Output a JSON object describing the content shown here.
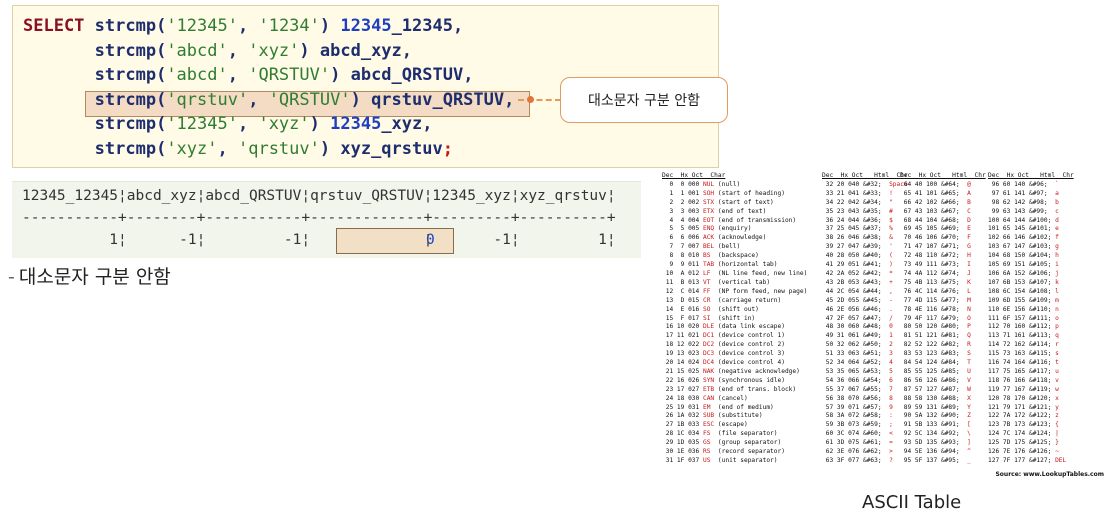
{
  "sql": {
    "keyword": "SELECT",
    "lines": [
      {
        "fn": "strcmp",
        "a": "'12345'",
        "b": "'1234'",
        "alias_num": "12345",
        "alias_rest": "_12345",
        "end": ","
      },
      {
        "fn": "strcmp",
        "a": "'abcd'",
        "b": "'xyz'",
        "alias_num": "",
        "alias_rest": "abcd_xyz",
        "end": ","
      },
      {
        "fn": "strcmp",
        "a": "'abcd'",
        "b": "'QRSTUV'",
        "alias_num": "",
        "alias_rest": "abcd_QRSTUV",
        "end": ","
      },
      {
        "fn": "strcmp",
        "a": "'qrstuv'",
        "b": "'QRSTUV'",
        "alias_num": "",
        "alias_rest": "qrstuv_QRSTUV",
        "end": ","
      },
      {
        "fn": "strcmp",
        "a": "'12345'",
        "b": "'xyz'",
        "alias_num": "12345",
        "alias_rest": "_xyz",
        "end": ","
      },
      {
        "fn": "strcmp",
        "a": "'xyz'",
        "b": "'qrstuv'",
        "alias_num": "",
        "alias_rest": "xyz_qrstuv",
        "end": ";"
      }
    ]
  },
  "callout_text": "대소문자 구분 안함",
  "result": {
    "header": "12345_12345¦abcd_xyz¦abcd_QRSTUV¦qrstuv_QRSTUV¦12345_xyz¦xyz_qrstuv¦",
    "separator": "-----------+--------+-----------+-------------+---------+----------+",
    "row": "          1¦      -1¦         -1¦             ¦       -1¦         1¦",
    "highlight_value": "0"
  },
  "note": {
    "dash": "-",
    "text": "대소문자 구분 안함"
  },
  "ascii": {
    "headers": [
      "Dec  Hx Oct  Char",
      "Dec  Hx Oct   Html  Chr",
      "Dec  Hx Oct   Html  Chr",
      "Dec  Hx Oct   Html  Chr"
    ],
    "col1": [
      [
        "0",
        "0",
        "000",
        "NUL",
        "(null)"
      ],
      [
        "1",
        "1",
        "001",
        "SOH",
        "(start of heading)"
      ],
      [
        "2",
        "2",
        "002",
        "STX",
        "(start of text)"
      ],
      [
        "3",
        "3",
        "003",
        "ETX",
        "(end of text)"
      ],
      [
        "4",
        "4",
        "004",
        "EOT",
        "(end of transmission)"
      ],
      [
        "5",
        "5",
        "005",
        "ENQ",
        "(enquiry)"
      ],
      [
        "6",
        "6",
        "006",
        "ACK",
        "(acknowledge)"
      ],
      [
        "7",
        "7",
        "007",
        "BEL",
        "(bell)"
      ],
      [
        "8",
        "8",
        "010",
        "BS",
        "(backspace)"
      ],
      [
        "9",
        "9",
        "011",
        "TAB",
        "(horizontal tab)"
      ],
      [
        "10",
        "A",
        "012",
        "LF",
        "(NL line feed, new line)"
      ],
      [
        "11",
        "B",
        "013",
        "VT",
        "(vertical tab)"
      ],
      [
        "12",
        "C",
        "014",
        "FF",
        "(NP form feed, new page)"
      ],
      [
        "13",
        "D",
        "015",
        "CR",
        "(carriage return)"
      ],
      [
        "14",
        "E",
        "016",
        "SO",
        "(shift out)"
      ],
      [
        "15",
        "F",
        "017",
        "SI",
        "(shift in)"
      ],
      [
        "16",
        "10",
        "020",
        "DLE",
        "(data link escape)"
      ],
      [
        "17",
        "11",
        "021",
        "DC1",
        "(device control 1)"
      ],
      [
        "18",
        "12",
        "022",
        "DC2",
        "(device control 2)"
      ],
      [
        "19",
        "13",
        "023",
        "DC3",
        "(device control 3)"
      ],
      [
        "20",
        "14",
        "024",
        "DC4",
        "(device control 4)"
      ],
      [
        "21",
        "15",
        "025",
        "NAK",
        "(negative acknowledge)"
      ],
      [
        "22",
        "16",
        "026",
        "SYN",
        "(synchronous idle)"
      ],
      [
        "23",
        "17",
        "027",
        "ETB",
        "(end of trans. block)"
      ],
      [
        "24",
        "18",
        "030",
        "CAN",
        "(cancel)"
      ],
      [
        "25",
        "19",
        "031",
        "EM",
        "(end of medium)"
      ],
      [
        "26",
        "1A",
        "032",
        "SUB",
        "(substitute)"
      ],
      [
        "27",
        "1B",
        "033",
        "ESC",
        "(escape)"
      ],
      [
        "28",
        "1C",
        "034",
        "FS",
        "(file separator)"
      ],
      [
        "29",
        "1D",
        "035",
        "GS",
        "(group separator)"
      ],
      [
        "30",
        "1E",
        "036",
        "RS",
        "(record separator)"
      ],
      [
        "31",
        "1F",
        "037",
        "US",
        "(unit separator)"
      ]
    ],
    "col2": [
      [
        "32",
        "20",
        "040",
        "&#32;",
        "Space"
      ],
      [
        "33",
        "21",
        "041",
        "&#33;",
        "!"
      ],
      [
        "34",
        "22",
        "042",
        "&#34;",
        "\""
      ],
      [
        "35",
        "23",
        "043",
        "&#35;",
        "#"
      ],
      [
        "36",
        "24",
        "044",
        "&#36;",
        "$"
      ],
      [
        "37",
        "25",
        "045",
        "&#37;",
        "%"
      ],
      [
        "38",
        "26",
        "046",
        "&#38;",
        "&"
      ],
      [
        "39",
        "27",
        "047",
        "&#39;",
        "'"
      ],
      [
        "40",
        "28",
        "050",
        "&#40;",
        "("
      ],
      [
        "41",
        "29",
        "051",
        "&#41;",
        ")"
      ],
      [
        "42",
        "2A",
        "052",
        "&#42;",
        "*"
      ],
      [
        "43",
        "2B",
        "053",
        "&#43;",
        "+"
      ],
      [
        "44",
        "2C",
        "054",
        "&#44;",
        ","
      ],
      [
        "45",
        "2D",
        "055",
        "&#45;",
        "-"
      ],
      [
        "46",
        "2E",
        "056",
        "&#46;",
        "."
      ],
      [
        "47",
        "2F",
        "057",
        "&#47;",
        "/"
      ],
      [
        "48",
        "30",
        "060",
        "&#48;",
        "0"
      ],
      [
        "49",
        "31",
        "061",
        "&#49;",
        "1"
      ],
      [
        "50",
        "32",
        "062",
        "&#50;",
        "2"
      ],
      [
        "51",
        "33",
        "063",
        "&#51;",
        "3"
      ],
      [
        "52",
        "34",
        "064",
        "&#52;",
        "4"
      ],
      [
        "53",
        "35",
        "065",
        "&#53;",
        "5"
      ],
      [
        "54",
        "36",
        "066",
        "&#54;",
        "6"
      ],
      [
        "55",
        "37",
        "067",
        "&#55;",
        "7"
      ],
      [
        "56",
        "38",
        "070",
        "&#56;",
        "8"
      ],
      [
        "57",
        "39",
        "071",
        "&#57;",
        "9"
      ],
      [
        "58",
        "3A",
        "072",
        "&#58;",
        ":"
      ],
      [
        "59",
        "3B",
        "073",
        "&#59;",
        ";"
      ],
      [
        "60",
        "3C",
        "074",
        "&#60;",
        "<"
      ],
      [
        "61",
        "3D",
        "075",
        "&#61;",
        "="
      ],
      [
        "62",
        "3E",
        "076",
        "&#62;",
        ">"
      ],
      [
        "63",
        "3F",
        "077",
        "&#63;",
        "?"
      ]
    ],
    "col3": [
      [
        "64",
        "40",
        "100",
        "&#64;",
        "@"
      ],
      [
        "65",
        "41",
        "101",
        "&#65;",
        "A"
      ],
      [
        "66",
        "42",
        "102",
        "&#66;",
        "B"
      ],
      [
        "67",
        "43",
        "103",
        "&#67;",
        "C"
      ],
      [
        "68",
        "44",
        "104",
        "&#68;",
        "D"
      ],
      [
        "69",
        "45",
        "105",
        "&#69;",
        "E"
      ],
      [
        "70",
        "46",
        "106",
        "&#70;",
        "F"
      ],
      [
        "71",
        "47",
        "107",
        "&#71;",
        "G"
      ],
      [
        "72",
        "48",
        "110",
        "&#72;",
        "H"
      ],
      [
        "73",
        "49",
        "111",
        "&#73;",
        "I"
      ],
      [
        "74",
        "4A",
        "112",
        "&#74;",
        "J"
      ],
      [
        "75",
        "4B",
        "113",
        "&#75;",
        "K"
      ],
      [
        "76",
        "4C",
        "114",
        "&#76;",
        "L"
      ],
      [
        "77",
        "4D",
        "115",
        "&#77;",
        "M"
      ],
      [
        "78",
        "4E",
        "116",
        "&#78;",
        "N"
      ],
      [
        "79",
        "4F",
        "117",
        "&#79;",
        "O"
      ],
      [
        "80",
        "50",
        "120",
        "&#80;",
        "P"
      ],
      [
        "81",
        "51",
        "121",
        "&#81;",
        "Q"
      ],
      [
        "82",
        "52",
        "122",
        "&#82;",
        "R"
      ],
      [
        "83",
        "53",
        "123",
        "&#83;",
        "S"
      ],
      [
        "84",
        "54",
        "124",
        "&#84;",
        "T"
      ],
      [
        "85",
        "55",
        "125",
        "&#85;",
        "U"
      ],
      [
        "86",
        "56",
        "126",
        "&#86;",
        "V"
      ],
      [
        "87",
        "57",
        "127",
        "&#87;",
        "W"
      ],
      [
        "88",
        "58",
        "130",
        "&#88;",
        "X"
      ],
      [
        "89",
        "59",
        "131",
        "&#89;",
        "Y"
      ],
      [
        "90",
        "5A",
        "132",
        "&#90;",
        "Z"
      ],
      [
        "91",
        "5B",
        "133",
        "&#91;",
        "["
      ],
      [
        "92",
        "5C",
        "134",
        "&#92;",
        "\\"
      ],
      [
        "93",
        "5D",
        "135",
        "&#93;",
        "]"
      ],
      [
        "94",
        "5E",
        "136",
        "&#94;",
        "^"
      ],
      [
        "95",
        "5F",
        "137",
        "&#95;",
        "_"
      ]
    ],
    "col4": [
      [
        "96",
        "60",
        "140",
        "&#96;",
        "`"
      ],
      [
        "97",
        "61",
        "141",
        "&#97;",
        "a"
      ],
      [
        "98",
        "62",
        "142",
        "&#98;",
        "b"
      ],
      [
        "99",
        "63",
        "143",
        "&#99;",
        "c"
      ],
      [
        "100",
        "64",
        "144",
        "&#100;",
        "d"
      ],
      [
        "101",
        "65",
        "145",
        "&#101;",
        "e"
      ],
      [
        "102",
        "66",
        "146",
        "&#102;",
        "f"
      ],
      [
        "103",
        "67",
        "147",
        "&#103;",
        "g"
      ],
      [
        "104",
        "68",
        "150",
        "&#104;",
        "h"
      ],
      [
        "105",
        "69",
        "151",
        "&#105;",
        "i"
      ],
      [
        "106",
        "6A",
        "152",
        "&#106;",
        "j"
      ],
      [
        "107",
        "6B",
        "153",
        "&#107;",
        "k"
      ],
      [
        "108",
        "6C",
        "154",
        "&#108;",
        "l"
      ],
      [
        "109",
        "6D",
        "155",
        "&#109;",
        "m"
      ],
      [
        "110",
        "6E",
        "156",
        "&#110;",
        "n"
      ],
      [
        "111",
        "6F",
        "157",
        "&#111;",
        "o"
      ],
      [
        "112",
        "70",
        "160",
        "&#112;",
        "p"
      ],
      [
        "113",
        "71",
        "161",
        "&#113;",
        "q"
      ],
      [
        "114",
        "72",
        "162",
        "&#114;",
        "r"
      ],
      [
        "115",
        "73",
        "163",
        "&#115;",
        "s"
      ],
      [
        "116",
        "74",
        "164",
        "&#116;",
        "t"
      ],
      [
        "117",
        "75",
        "165",
        "&#117;",
        "u"
      ],
      [
        "118",
        "76",
        "166",
        "&#118;",
        "v"
      ],
      [
        "119",
        "77",
        "167",
        "&#119;",
        "w"
      ],
      [
        "120",
        "78",
        "170",
        "&#120;",
        "x"
      ],
      [
        "121",
        "79",
        "171",
        "&#121;",
        "y"
      ],
      [
        "122",
        "7A",
        "172",
        "&#122;",
        "z"
      ],
      [
        "123",
        "7B",
        "173",
        "&#123;",
        "{"
      ],
      [
        "124",
        "7C",
        "174",
        "&#124;",
        "|"
      ],
      [
        "125",
        "7D",
        "175",
        "&#125;",
        "}"
      ],
      [
        "126",
        "7E",
        "176",
        "&#126;",
        "~"
      ],
      [
        "127",
        "7F",
        "177",
        "&#127;",
        "DEL"
      ]
    ],
    "source": "Source: www.LookupTables.com",
    "caption": "ASCII Table"
  },
  "colors": {
    "highlight": "#f3dcc3",
    "callout_border": "#e29a5f",
    "code_bg": "#fffbe6",
    "result_bg": "#f2f5ec",
    "ascii_red": "#c81818"
  }
}
